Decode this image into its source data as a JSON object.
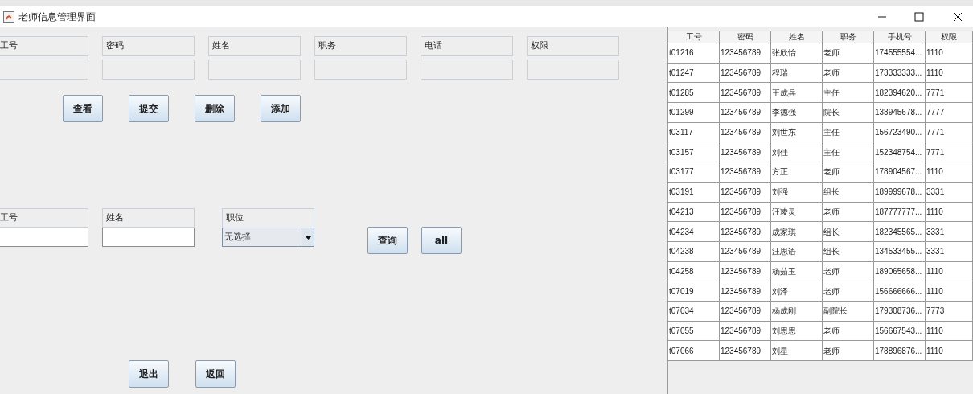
{
  "window": {
    "title": "老师信息管理界面"
  },
  "top_form": {
    "fields": [
      {
        "label": "工号"
      },
      {
        "label": "密码"
      },
      {
        "label": "姓名"
      },
      {
        "label": "职务"
      },
      {
        "label": "电话"
      },
      {
        "label": "权限"
      }
    ]
  },
  "top_buttons": [
    "查看",
    "提交",
    "删除",
    "添加"
  ],
  "query_form": {
    "fields": [
      {
        "kind": "text",
        "label": "工号"
      },
      {
        "kind": "text",
        "label": "姓名"
      },
      {
        "kind": "select",
        "label": "职位",
        "value": "无选择"
      }
    ]
  },
  "query_buttons": [
    "查询",
    "all"
  ],
  "bottom_buttons": [
    "退出",
    "返回"
  ],
  "table": {
    "columns": [
      "工号",
      "密码",
      "姓名",
      "职务",
      "手机号",
      "权限"
    ],
    "rows": [
      [
        "t01216",
        "123456789",
        "张欣怡",
        "老师",
        "174555554...",
        "1110"
      ],
      [
        "t01247",
        "123456789",
        "程瑞",
        "老师",
        "173333333...",
        "1110"
      ],
      [
        "t01285",
        "123456789",
        "王成兵",
        "主任",
        "182394620...",
        "7771"
      ],
      [
        "t01299",
        "123456789",
        "李德强",
        "院长",
        "138945678...",
        "7777"
      ],
      [
        "t03117",
        "123456789",
        "刘世东",
        "主任",
        "156723490...",
        "7771"
      ],
      [
        "t03157",
        "123456789",
        "刘佳",
        "主任",
        "152348754...",
        "7771"
      ],
      [
        "t03177",
        "123456789",
        "方正",
        "老师",
        "178904567...",
        "1110"
      ],
      [
        "t03191",
        "123456789",
        "刘强",
        "组长",
        "189999678...",
        "3331"
      ],
      [
        "t04213",
        "123456789",
        "汪凌灵",
        "老师",
        "187777777...",
        "1110"
      ],
      [
        "t04234",
        "123456789",
        "成家琪",
        "组长",
        "182345565...",
        "3331"
      ],
      [
        "t04238",
        "123456789",
        "汪思语",
        "组长",
        "134533455...",
        "3331"
      ],
      [
        "t04258",
        "123456789",
        "杨茹玉",
        "老师",
        "189065658...",
        "1110"
      ],
      [
        "t07019",
        "123456789",
        "刘泽",
        "老师",
        "156666666...",
        "1110"
      ],
      [
        "t07034",
        "123456789",
        "杨成刚",
        "副院长",
        "179308736...",
        "7773"
      ],
      [
        "t07055",
        "123456789",
        "刘思思",
        "老师",
        "156667543...",
        "1110"
      ],
      [
        "t07066",
        "123456789",
        "刘星",
        "老师",
        "178896876...",
        "1110"
      ]
    ]
  }
}
